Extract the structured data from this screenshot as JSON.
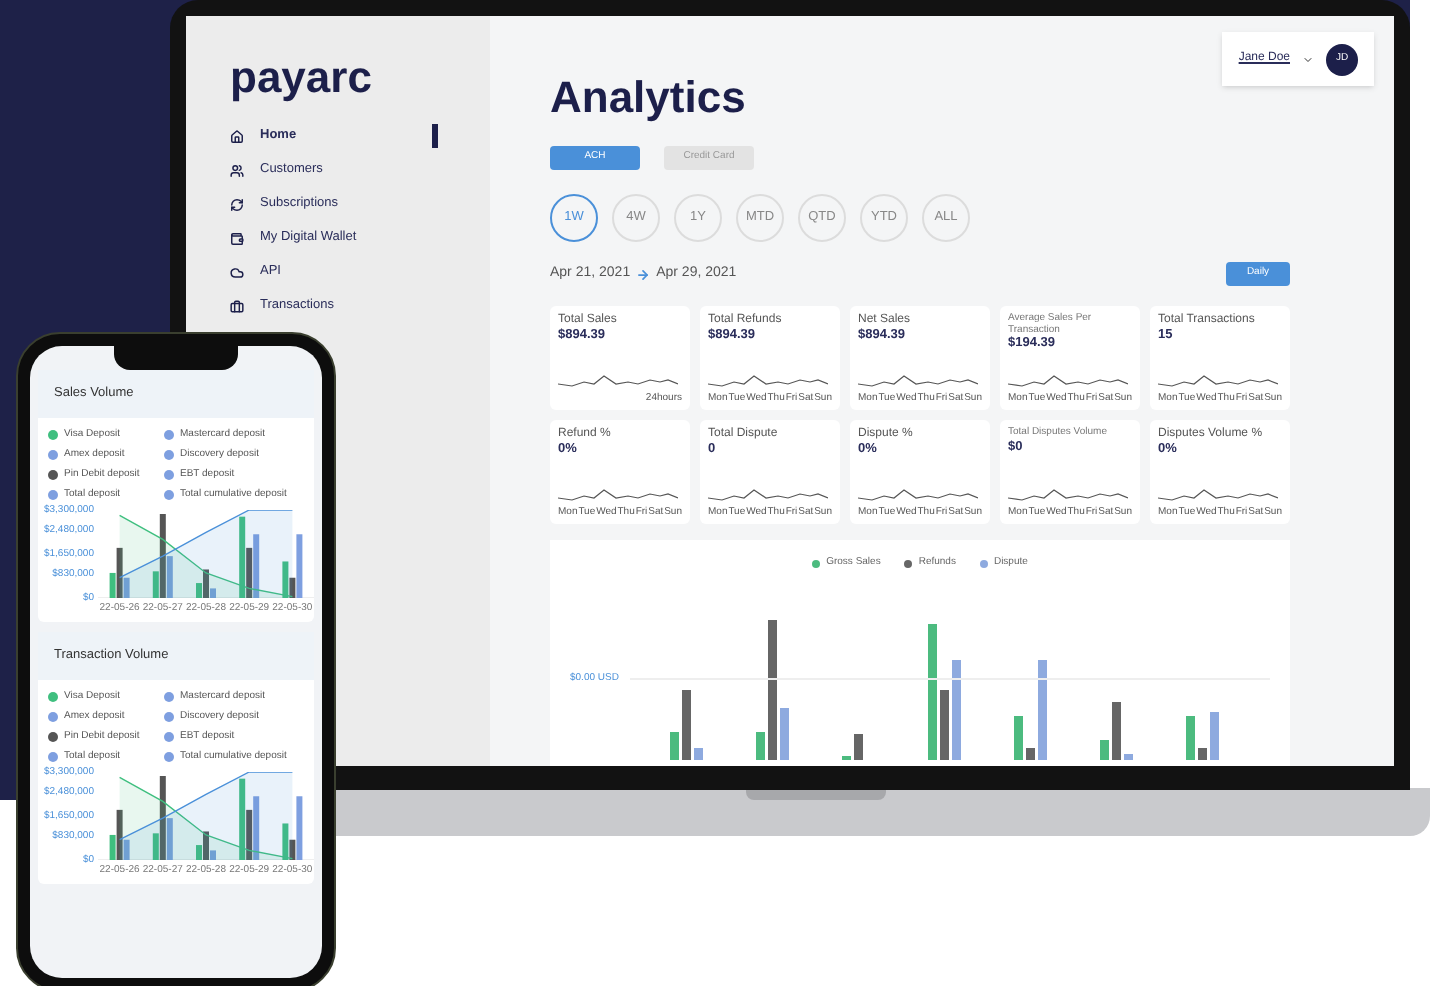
{
  "sidebar": {
    "logo": "payarc",
    "items": [
      {
        "label": "Home",
        "selected": true
      },
      {
        "label": "Customers",
        "selected": false
      },
      {
        "label": "Subscriptions",
        "selected": false
      },
      {
        "label": "My Digital Wallet",
        "selected": false
      },
      {
        "label": "API",
        "selected": false
      },
      {
        "label": "Transactions",
        "selected": false
      }
    ]
  },
  "user_menu": {
    "name": "Jane Doe",
    "initials": "JD"
  },
  "title": "Analytics",
  "payment_tabs": [
    {
      "label": "ACH",
      "selected": true
    },
    {
      "label": "Credit Card",
      "selected": false
    }
  ],
  "periods": [
    {
      "label": "1W",
      "selected": true
    },
    {
      "label": "4W",
      "selected": false
    },
    {
      "label": "1Y",
      "selected": false
    },
    {
      "label": "MTD",
      "selected": false
    },
    {
      "label": "QTD",
      "selected": false
    },
    {
      "label": "YTD",
      "selected": false
    },
    {
      "label": "ALL",
      "selected": false
    }
  ],
  "date_range": {
    "start": "Apr 21, 2021",
    "end": "Apr 29, 2021"
  },
  "interval_button": "Daily",
  "stats": [
    {
      "kind": "standard",
      "title": "Total Sales",
      "value": "$894.39",
      "axis": [
        "24hours"
      ]
    },
    {
      "kind": "standard",
      "title": "Total Refunds",
      "value": "$894.39",
      "axis": [
        "Mon",
        "Tue",
        "Wed",
        "Thu",
        "Fri",
        "Sat",
        "Sun"
      ]
    },
    {
      "kind": "standard",
      "title": "Net Sales",
      "value": "$894.39",
      "axis": [
        "Mon",
        "Tue",
        "Wed",
        "Thu",
        "Fri",
        "Sat",
        "Sun"
      ]
    },
    {
      "kind": "long_title",
      "title": "Average Sales Per Transaction",
      "value": "$194.39",
      "axis": [
        "Mon",
        "Tue",
        "Wed",
        "Thu",
        "Fri",
        "Sat",
        "Sun"
      ]
    },
    {
      "kind": "standard",
      "title": "Total Transactions",
      "value": "15",
      "axis": [
        "Mon",
        "Tue",
        "Wed",
        "Thu",
        "Fri",
        "Sat",
        "Sun"
      ]
    },
    {
      "kind": "standard",
      "title": "Refund %",
      "value": "0%",
      "axis": [
        "Mon",
        "Tue",
        "Wed",
        "Thu",
        "Fri",
        "Sat",
        "Sun"
      ]
    },
    {
      "kind": "standard",
      "title": "Total Dispute",
      "value": "0",
      "axis": [
        "Mon",
        "Tue",
        "Wed",
        "Thu",
        "Fri",
        "Sat",
        "Sun"
      ]
    },
    {
      "kind": "standard",
      "title": "Dispute %",
      "value": "0%",
      "axis": [
        "Mon",
        "Tue",
        "Wed",
        "Thu",
        "Fri",
        "Sat",
        "Sun"
      ]
    },
    {
      "kind": "long_title",
      "title": "Total Disputes Volume",
      "value": "$0",
      "axis": [
        "Mon",
        "Tue",
        "Wed",
        "Thu",
        "Fri",
        "Sat",
        "Sun"
      ]
    },
    {
      "kind": "standard",
      "title": "Disputes Volume %",
      "value": "0%",
      "axis": [
        "Mon",
        "Tue",
        "Wed",
        "Thu",
        "Fri",
        "Sat",
        "Sun"
      ]
    }
  ],
  "sales_chart": {
    "legend": [
      {
        "label": "Gross Sales",
        "color": "#4cbb7f"
      },
      {
        "label": "Refunds",
        "color": "#666666"
      },
      {
        "label": "Dispute",
        "color": "#8eaadf"
      }
    ],
    "y_label": "$0.00 USD"
  },
  "phone_panels": [
    {
      "title": "Sales Volume",
      "legend": [
        {
          "label": "Visa Deposit",
          "color": "#3fbf7f"
        },
        {
          "label": "Mastercard deposit",
          "color": "#7e9fe0"
        },
        {
          "label": "Amex deposit",
          "color": "#7e9fe0"
        },
        {
          "label": "Discovery deposit",
          "color": "#7e9fe0"
        },
        {
          "label": "Pin Debit deposit",
          "color": "#555555"
        },
        {
          "label": "EBT deposit",
          "color": "#7e9fe0"
        },
        {
          "label": "Total deposit",
          "color": "#7e9fe0"
        },
        {
          "label": "Total cumulative deposit",
          "color": "#7e9fe0"
        }
      ],
      "chart_data": {
        "type": "bar",
        "stacked": false,
        "categories": [
          "22-05-26",
          "22-05-27",
          "22-05-28",
          "22-05-29",
          "22-05-30"
        ],
        "ylim": [
          0,
          3300000
        ],
        "yticks": [
          {
            "value": 0,
            "label": "$0"
          },
          {
            "value": 830000,
            "label": "$830,000"
          },
          {
            "value": 1650000,
            "label": "$1,650,000"
          },
          {
            "value": 2480000,
            "label": "$2,480,000"
          },
          {
            "value": 3300000,
            "label": "$3,300,000"
          }
        ],
        "series": [
          {
            "type": "bar",
            "color": "#3fbf7f",
            "values": [
              940000,
              1000000,
              560000,
              3050000,
              1370000
            ]
          },
          {
            "type": "bar",
            "color": "#555555",
            "values": [
              1880000,
              3150000,
              1070000,
              1880000,
              760000
            ]
          },
          {
            "type": "bar",
            "color": "#7e9fe0",
            "values": [
              760000,
              1570000,
              360000,
              2390000,
              2390000
            ]
          },
          {
            "type": "area",
            "color": "#3fbf7f",
            "values": [
              3100000,
              2200000,
              940000,
              360000,
              50000
            ]
          },
          {
            "type": "area",
            "color": "#4a90d9",
            "values": [
              760000,
              1570000,
              2460000,
              3300000,
              3300000
            ]
          }
        ]
      }
    },
    {
      "title": "Transaction Volume",
      "legend": [
        {
          "label": "Visa Deposit",
          "color": "#3fbf7f"
        },
        {
          "label": "Mastercard deposit",
          "color": "#7e9fe0"
        },
        {
          "label": "Amex deposit",
          "color": "#7e9fe0"
        },
        {
          "label": "Discovery deposit",
          "color": "#7e9fe0"
        },
        {
          "label": "Pin Debit deposit",
          "color": "#555555"
        },
        {
          "label": "EBT deposit",
          "color": "#7e9fe0"
        },
        {
          "label": "Total deposit",
          "color": "#7e9fe0"
        },
        {
          "label": "Total cumulative deposit",
          "color": "#7e9fe0"
        }
      ],
      "chart_data": {
        "type": "bar",
        "stacked": false,
        "categories": [
          "22-05-26",
          "22-05-27",
          "22-05-28",
          "22-05-29",
          "22-05-30"
        ],
        "ylim": [
          0,
          3300000
        ],
        "yticks": [
          {
            "value": 0,
            "label": "$0"
          },
          {
            "value": 830000,
            "label": "$830,000"
          },
          {
            "value": 1650000,
            "label": "$1,650,000"
          },
          {
            "value": 2480000,
            "label": "$2,480,000"
          },
          {
            "value": 3300000,
            "label": "$3,300,000"
          }
        ],
        "series": [
          {
            "type": "bar",
            "color": "#3fbf7f",
            "values": [
              940000,
              1000000,
              560000,
              3050000,
              1370000
            ]
          },
          {
            "type": "bar",
            "color": "#555555",
            "values": [
              1880000,
              3150000,
              1070000,
              1880000,
              760000
            ]
          },
          {
            "type": "bar",
            "color": "#7e9fe0",
            "values": [
              760000,
              1570000,
              360000,
              2390000,
              2390000
            ]
          },
          {
            "type": "area",
            "color": "#3fbf7f",
            "values": [
              3100000,
              2200000,
              940000,
              360000,
              50000
            ]
          },
          {
            "type": "area",
            "color": "#4a90d9",
            "values": [
              760000,
              1570000,
              2460000,
              3300000,
              3300000
            ]
          }
        ]
      }
    }
  ]
}
